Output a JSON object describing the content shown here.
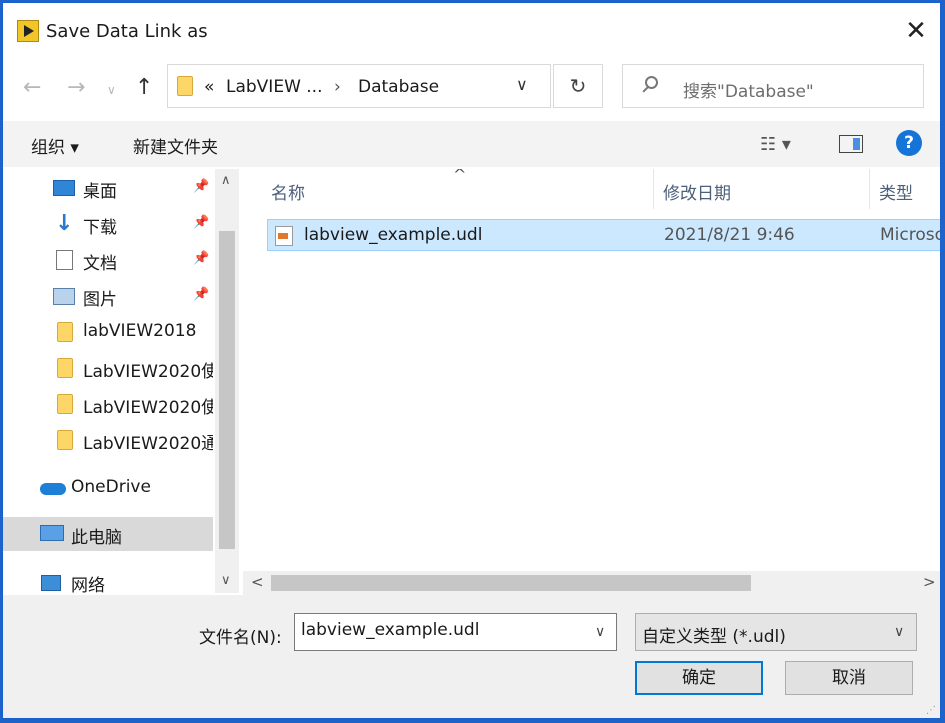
{
  "window": {
    "title": "Save Data Link as"
  },
  "address": {
    "overflow": "«",
    "crumbs": [
      "LabVIEW ...",
      "Database"
    ],
    "separator": "›"
  },
  "search": {
    "placeholder": "搜索\"Database\""
  },
  "toolbar": {
    "organize": "组织 ▾",
    "new_folder": "新建文件夹",
    "help": "?"
  },
  "nav": {
    "items": [
      {
        "label": "桌面",
        "icon": "desktop-icon",
        "pinned": true
      },
      {
        "label": "下载",
        "icon": "download-icon",
        "pinned": true
      },
      {
        "label": "文档",
        "icon": "document-icon",
        "pinned": true
      },
      {
        "label": "图片",
        "icon": "pictures-icon",
        "pinned": true
      },
      {
        "label": "labVIEW2018",
        "icon": "folder-icon"
      },
      {
        "label": "LabVIEW2020使",
        "icon": "folder-icon"
      },
      {
        "label": "LabVIEW2020使",
        "icon": "folder-icon"
      },
      {
        "label": "LabVIEW2020通",
        "icon": "folder-icon"
      },
      {
        "label": "OneDrive",
        "icon": "onedrive-icon"
      },
      {
        "label": "此电脑",
        "icon": "computer-icon",
        "selected": true
      },
      {
        "label": "网络",
        "icon": "network-icon"
      }
    ]
  },
  "filelist": {
    "columns": [
      "名称",
      "修改日期",
      "类型"
    ],
    "rows": [
      {
        "name": "labview_example.udl",
        "modified": "2021/8/21 9:46",
        "type": "Microsof"
      }
    ]
  },
  "bottom": {
    "filename_label": "文件名(N):",
    "filename_value": "labview_example.udl",
    "filetype": "自定义类型 (*.udl)",
    "ok_label": "确定",
    "cancel_label": "取消"
  },
  "colors": {
    "accent": "#0078d7",
    "selection": "#cce8ff",
    "frame": "#1e64c8"
  }
}
